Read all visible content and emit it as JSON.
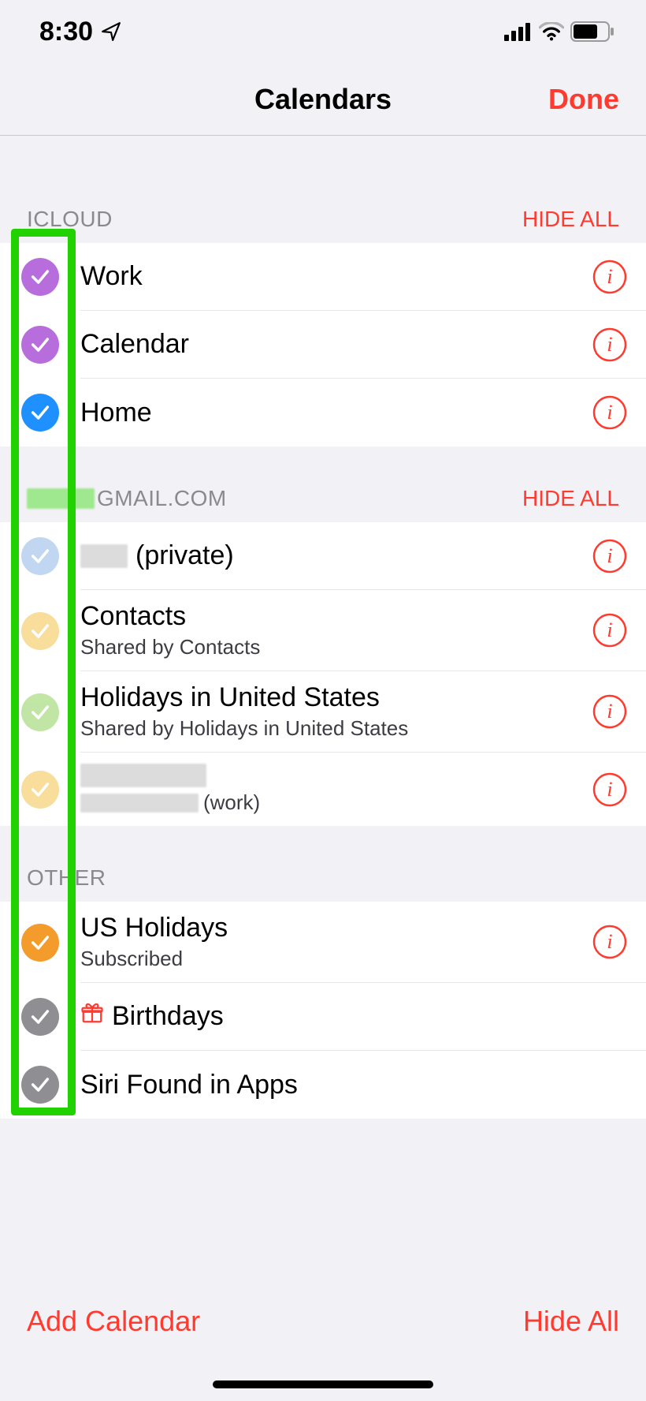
{
  "status": {
    "time": "8:30"
  },
  "nav": {
    "title": "Calendars",
    "done": "Done"
  },
  "sections": [
    {
      "title_prefix": "",
      "title": "ICLOUD",
      "action": "HIDE ALL",
      "items": [
        {
          "color": "#b86ddc",
          "faded": false,
          "title": "Work",
          "sub": "",
          "info": true,
          "iconGift": false,
          "blurTitle": false,
          "blurSub": false
        },
        {
          "color": "#b86ddc",
          "faded": false,
          "title": "Calendar",
          "sub": "",
          "info": true,
          "iconGift": false,
          "blurTitle": false,
          "blurSub": false
        },
        {
          "color": "#1e90ff",
          "faded": false,
          "title": "Home",
          "sub": "",
          "info": true,
          "iconGift": false,
          "blurTitle": false,
          "blurSub": false
        }
      ]
    },
    {
      "title_prefix": "blur",
      "title": "GMAIL.COM",
      "action": "HIDE ALL",
      "items": [
        {
          "color": "#8fb8e6",
          "faded": true,
          "title": "(private)",
          "sub": "",
          "info": true,
          "iconGift": false,
          "blurTitle": true,
          "blurSub": false
        },
        {
          "color": "#f3c24a",
          "faded": true,
          "title": "Contacts",
          "sub": "Shared by Contacts",
          "info": true,
          "iconGift": false,
          "blurTitle": false,
          "blurSub": false
        },
        {
          "color": "#8fd15a",
          "faded": true,
          "title": "Holidays in United States",
          "sub": "Shared by Holidays in United States",
          "info": true,
          "iconGift": false,
          "blurTitle": false,
          "blurSub": false
        },
        {
          "color": "#f3c24a",
          "faded": true,
          "title": "",
          "sub": "(work)",
          "info": true,
          "iconGift": false,
          "blurTitle": true,
          "blurSub": true
        }
      ]
    },
    {
      "title_prefix": "",
      "title": "OTHER",
      "action": "",
      "items": [
        {
          "color": "#f39c2b",
          "faded": false,
          "title": "US Holidays",
          "sub": "Subscribed",
          "info": true,
          "iconGift": false,
          "blurTitle": false,
          "blurSub": false
        },
        {
          "color": "#8e8e93",
          "faded": false,
          "title": "Birthdays",
          "sub": "",
          "info": false,
          "iconGift": true,
          "blurTitle": false,
          "blurSub": false
        },
        {
          "color": "#8e8e93",
          "faded": false,
          "title": "Siri Found in Apps",
          "sub": "",
          "info": false,
          "iconGift": false,
          "blurTitle": false,
          "blurSub": false
        }
      ]
    }
  ],
  "toolbar": {
    "add": "Add Calendar",
    "hide": "Hide All"
  },
  "colors": {
    "accent": "#ff3b30"
  }
}
